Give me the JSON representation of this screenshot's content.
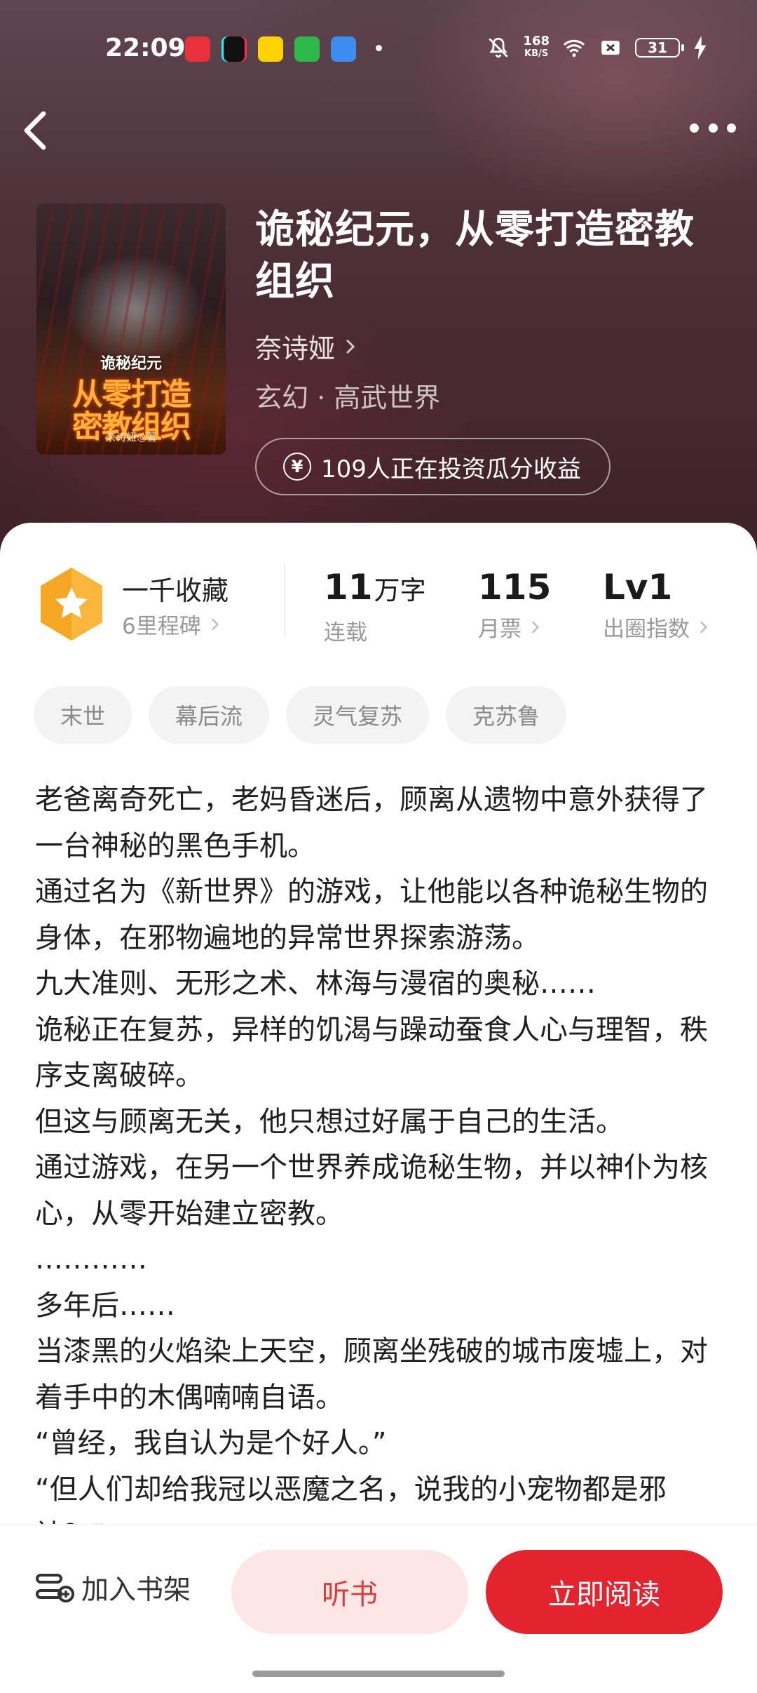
{
  "status_bar": {
    "time": "22:09",
    "net_speed_value": "168",
    "net_speed_unit": "KB/S",
    "battery": "31"
  },
  "book": {
    "title": "诡秘纪元，从零打造密教组织",
    "author": "奈诗娅",
    "genre": "玄幻 · 高武世界",
    "invest_text": "109人正在投资瓜分收益",
    "cover": {
      "small_title": "诡秘纪元",
      "line1": "从零打造",
      "line2": "密教组织",
      "author_line": "奈诗娅◎著"
    }
  },
  "stats": {
    "collect_title": "一千收藏",
    "collect_sub": "6里程碑",
    "words_value": "11",
    "words_unit": "万字",
    "words_label": "连载",
    "tickets_value": "115",
    "tickets_label": "月票",
    "level_value": "Lv1",
    "level_label": "出圈指数"
  },
  "tags": [
    "末世",
    "幕后流",
    "灵气复苏",
    "克苏鲁"
  ],
  "synopsis": [
    "老爸离奇死亡，老妈昏迷后，顾离从遗物中意外获得了一台神秘的黑色手机。",
    "通过名为《新世界》的游戏，让他能以各种诡秘生物的身体，在邪物遍地的异常世界探索游荡。",
    "九大准则、无形之术、林海与漫宿的奥秘……",
    "诡秘正在复苏，异样的饥渴与躁动蚕食人心与理智，秩序支离破碎。",
    "但这与顾离无关，他只想过好属于自己的生活。",
    "通过游戏，在另一个世界养成诡秘生物，并以神仆为核心，从零开始建立密教。",
    "…………",
    "多年后……",
    "当漆黑的火焰染上天空，顾离坐残破的城市废墟上，对着手中的木偶喃喃自语。",
    "“曾经，我自认为是个好人。”",
    "“但人们却给我冠以恶魔之名，说我的小宠物都是邪神？”"
  ],
  "bottom": {
    "shelf": "加入书架",
    "listen": "听书",
    "read": "立即阅读"
  },
  "colors": {
    "accent_red": "#e3242f",
    "listen_bg": "#fde6e6",
    "badge_orange": "#f5a623"
  }
}
